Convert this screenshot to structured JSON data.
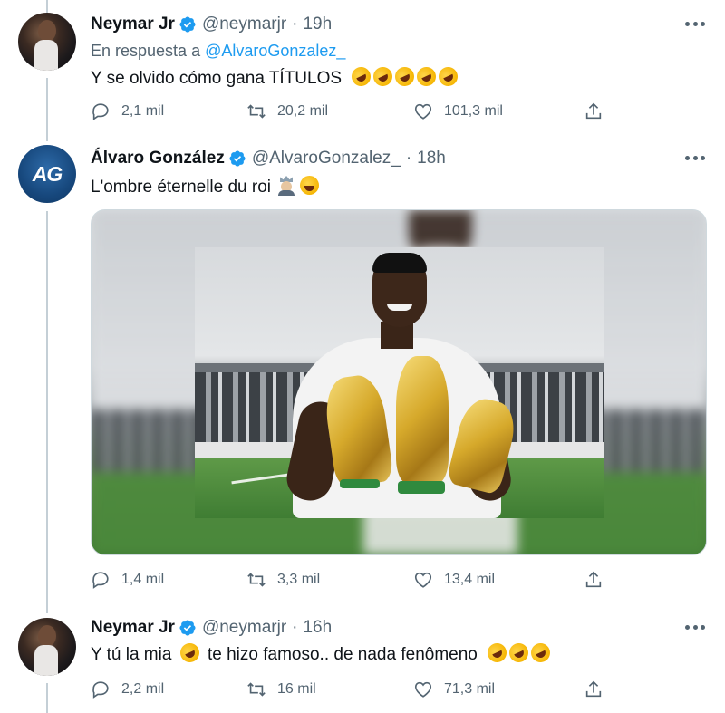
{
  "colors": {
    "accent": "#1d9bf0",
    "text_primary": "#0f1419",
    "text_secondary": "#536471",
    "thread_line": "#c4cfd6"
  },
  "tweets": [
    {
      "name": "Neymar Jr",
      "handle": "@neymarjr",
      "separator": "·",
      "time": "19h",
      "verified": true,
      "reply_prefix": "En respuesta a",
      "reply_handle": "@AlvaroGonzalez_",
      "text": "Y se olvido cómo gana TÍTULOS",
      "emoji": [
        "rofl",
        "rofl",
        "rofl",
        "rofl",
        "rofl"
      ],
      "replies": "2,1 mil",
      "retweets": "20,2 mil",
      "likes": "101,3 mil"
    },
    {
      "name": "Álvaro González",
      "handle": "@AlvaroGonzalez_",
      "separator": "·",
      "time": "18h",
      "verified": true,
      "avatar_text": "AG",
      "text": "L'ombre éternelle du roi",
      "emoji": [
        "king",
        "joy"
      ],
      "media": "photo",
      "replies": "1,4 mil",
      "retweets": "3,3 mil",
      "likes": "13,4 mil"
    },
    {
      "name": "Neymar Jr",
      "handle": "@neymarjr",
      "separator": "·",
      "time": "16h",
      "verified": true,
      "text_before": "Y tú la mia",
      "text_after": "te hizo famoso.. de nada fenômeno",
      "emoji": [
        "rofl",
        "rofl",
        "rofl",
        "rofl"
      ],
      "replies": "2,2 mil",
      "retweets": "16 mil",
      "likes": "71,3 mil"
    }
  ],
  "icons": {
    "reply": "reply-icon",
    "retweet": "retweet-icon",
    "like": "like-icon",
    "share": "share-icon",
    "more": "more-icon",
    "verified": "verified-badge-icon"
  }
}
